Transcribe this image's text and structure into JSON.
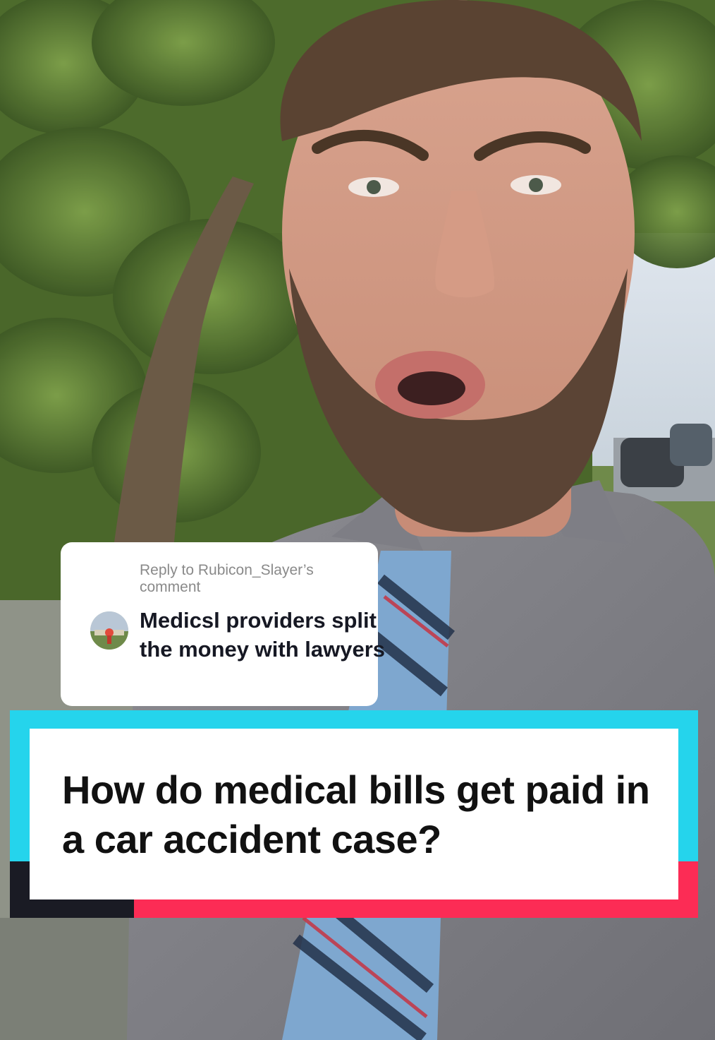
{
  "reply": {
    "header": "Reply to Rubicon_Slayer’s comment",
    "comment": "Medicsl providers split the money with lawyers",
    "avatar_icon": "user-avatar-icon"
  },
  "caption": {
    "text": "How do medical bills get paid in a car accident case?"
  },
  "colors": {
    "caption_cyan": "#25d4ec",
    "caption_red": "#fc2c55",
    "caption_dark": "#1a1b24",
    "reply_header_gray": "#8a8a8a",
    "text_dark": "#161823"
  }
}
